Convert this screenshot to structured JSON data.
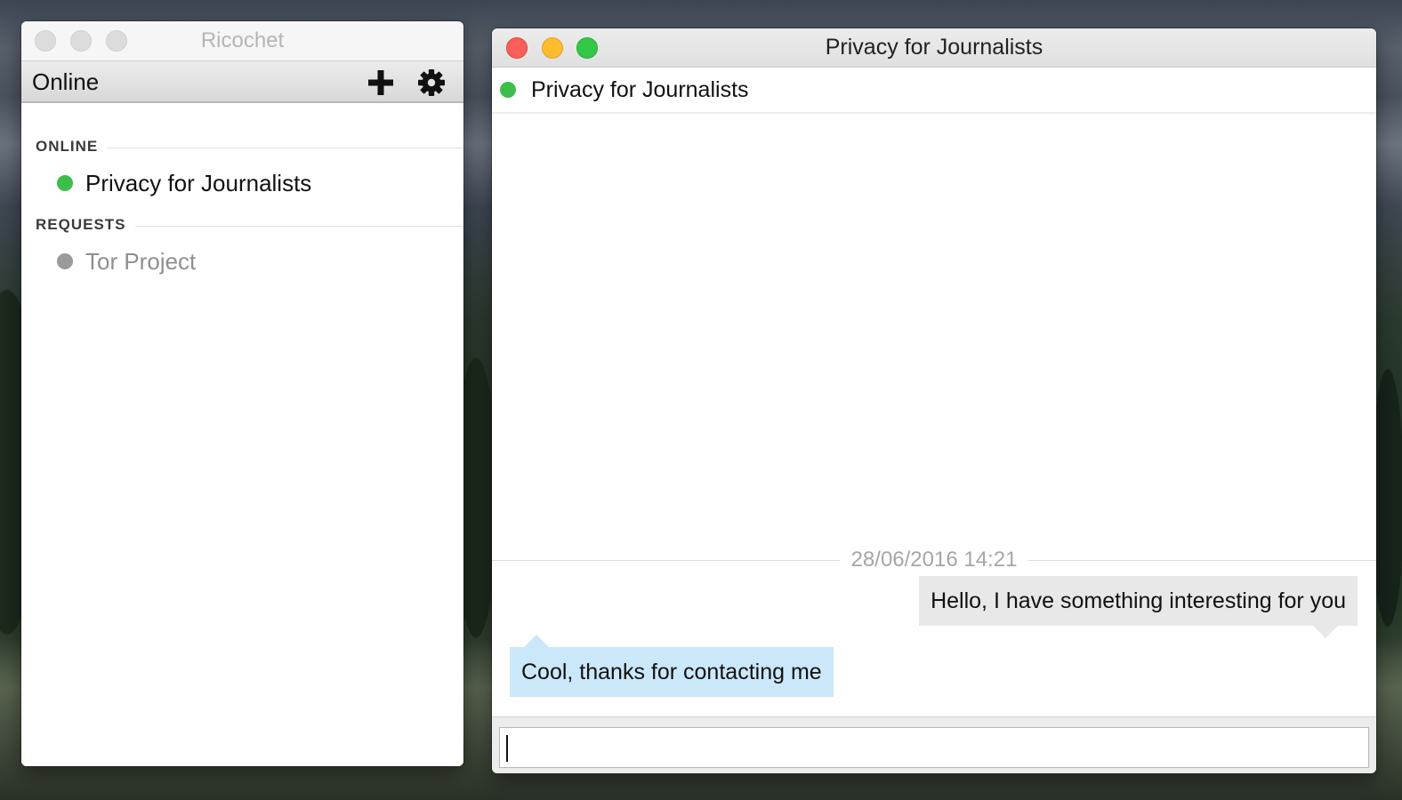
{
  "contacts_window": {
    "title": "Ricochet",
    "status": "Online",
    "add_icon": "plus-icon",
    "settings_icon": "gear-icon",
    "sections": [
      {
        "label": "ONLINE",
        "contacts": [
          {
            "name": "Privacy for Journalists",
            "status": "online",
            "status_color": "#3cbf4a"
          }
        ]
      },
      {
        "label": "REQUESTS",
        "contacts": [
          {
            "name": "Tor Project",
            "status": "pending",
            "status_color": "#9a9a9a"
          }
        ]
      }
    ]
  },
  "chat_window": {
    "title": "Privacy for Journalists",
    "peer_name": "Privacy for Journalists",
    "peer_status_color": "#3cbf4a",
    "date_separator": "28/06/2016 14:21",
    "messages": [
      {
        "direction": "outgoing",
        "text": "Hello, I have something interesting for you"
      },
      {
        "direction": "incoming",
        "text": "Cool, thanks for contacting me"
      }
    ],
    "composer": {
      "value": "",
      "placeholder": ""
    }
  },
  "colors": {
    "traffic_close": "#fc5f57",
    "traffic_minimize": "#fdbc2e",
    "traffic_maximize": "#33c748",
    "traffic_inactive": "#dcdcdc",
    "online": "#3cbf4a",
    "offline": "#9a9a9a",
    "bubble_outgoing": "#e8e8e8",
    "bubble_incoming": "#cbe8fb"
  }
}
